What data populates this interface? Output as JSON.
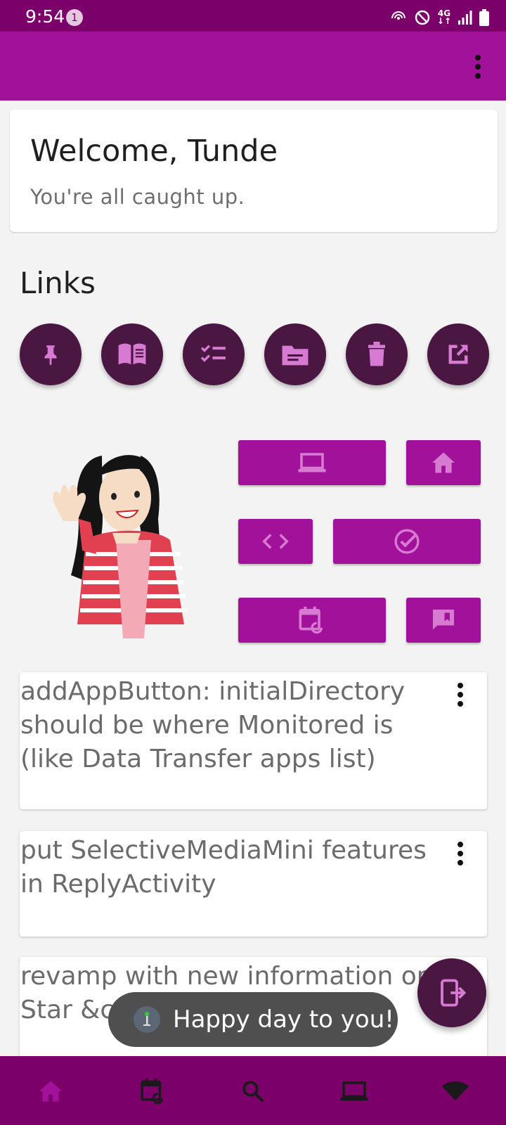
{
  "status_bar": {
    "time": "9:54",
    "notification_count": "1",
    "icons": [
      "hotspot-icon",
      "do-not-disturb-icon",
      "4g-icon",
      "signal-icon",
      "battery-icon"
    ],
    "network_label": "4G"
  },
  "colors": {
    "primary": "#a1119a",
    "primary_dark": "#7b0069",
    "accent_dark": "#4a1642"
  },
  "welcome": {
    "title": "Welcome, Tunde",
    "subtitle": "You're all caught up."
  },
  "links": {
    "heading": "Links",
    "buttons": [
      {
        "icon": "pin-icon"
      },
      {
        "icon": "book-icon"
      },
      {
        "icon": "checklist-icon"
      },
      {
        "icon": "folder-icon"
      },
      {
        "icon": "trash-icon"
      },
      {
        "icon": "open-external-icon"
      }
    ]
  },
  "quick_actions": [
    {
      "icon": "laptop-icon"
    },
    {
      "icon": "home-icon"
    },
    {
      "icon": "code-icon"
    },
    {
      "icon": "check-circle-icon"
    },
    {
      "icon": "calendar-sync-icon"
    },
    {
      "icon": "feedback-icon"
    }
  ],
  "tasks": [
    {
      "text": "addAppButton: initialDirectory should be where Monitored is (like Data Transfer apps list)"
    },
    {
      "text": "put SelectiveMediaMini features in ReplyActivity"
    },
    {
      "text": "revamp with new information on Star &c."
    }
  ],
  "toast": {
    "message": "Happy day to you!"
  },
  "bottom_nav": [
    {
      "icon": "home-icon",
      "selected": true
    },
    {
      "icon": "calendar-sync-icon",
      "selected": false
    },
    {
      "icon": "search-icon",
      "selected": false
    },
    {
      "icon": "laptop-icon",
      "selected": false
    },
    {
      "icon": "wifi-icon",
      "selected": false
    }
  ]
}
